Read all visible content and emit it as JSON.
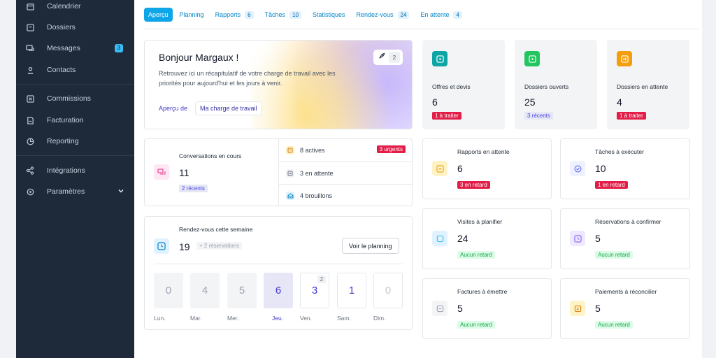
{
  "sidebar": {
    "items": [
      {
        "label": "Calendrier",
        "icon": "calendar-icon"
      },
      {
        "label": "Dossiers",
        "icon": "folder-icon"
      },
      {
        "label": "Messages",
        "icon": "messages-icon",
        "badge": "3"
      },
      {
        "label": "Contacts",
        "icon": "user-icon"
      },
      {
        "label": "Commissions",
        "icon": "commission-icon"
      },
      {
        "label": "Facturation",
        "icon": "invoice-icon"
      },
      {
        "label": "Reporting",
        "icon": "pie-chart-icon"
      },
      {
        "label": "Intégrations",
        "icon": "share-icon"
      },
      {
        "label": "Paramètres",
        "icon": "settings-icon"
      }
    ]
  },
  "tabs": [
    {
      "label": "Aperçu"
    },
    {
      "label": "Planning"
    },
    {
      "label": "Rapports",
      "count": "6"
    },
    {
      "label": "Tâches",
      "count": "10"
    },
    {
      "label": "Statistiques"
    },
    {
      "label": "Rendez-vous",
      "count": "24"
    },
    {
      "label": "En attente",
      "count": "4"
    }
  ],
  "welcome": {
    "title": "Bonjour Margaux !",
    "text": "Retrouvez ici un récapitulatif de votre charge de travail avec les priorités pour aujourd'hui et les jours à venir.",
    "apercu_label": "Aperçu de",
    "button": "Ma charge de travail",
    "rocket_count": "2"
  },
  "top_stats": [
    {
      "label": "Offres et devis",
      "value": "6",
      "badge": "1 à traiter",
      "badge_style": "red",
      "icon_color": "#0ea5a4"
    },
    {
      "label": "Dossiers ouverts",
      "value": "25",
      "badge": "3 récents",
      "badge_style": "lav",
      "icon_color": "#22c55e"
    },
    {
      "label": "Dossiers en attente",
      "value": "4",
      "badge": "1 à traiter",
      "badge_style": "red",
      "icon_color": "#f59e0b"
    }
  ],
  "conversations": {
    "label": "Conversations en cours",
    "value": "11",
    "badge": "2 récents",
    "rows": [
      {
        "text": "8 actives",
        "badge": "3 urgents"
      },
      {
        "text": "3 en attente"
      },
      {
        "text": "4 brouillons"
      }
    ]
  },
  "rdv": {
    "label": "Rendez-vous cette semaine",
    "value": "19",
    "extra": "+ 2 réservations",
    "button": "Voir le planning",
    "days": [
      {
        "label": "Lun.",
        "value": "0"
      },
      {
        "label": "Mar.",
        "value": "4"
      },
      {
        "label": "Mer.",
        "value": "5"
      },
      {
        "label": "Jeu.",
        "value": "6"
      },
      {
        "label": "Ven.",
        "value": "3",
        "sup": "2"
      },
      {
        "label": "Sam.",
        "value": "1"
      },
      {
        "label": "Dim.",
        "value": "0"
      }
    ]
  },
  "tasks": [
    {
      "label": "Rapports en attente",
      "value": "6",
      "badge": "3 en retard",
      "badge_style": "red",
      "icon": "report-icon",
      "icon_bg": "#fef3c7",
      "icon_fg": "#f59e0b"
    },
    {
      "label": "Tâches à exécuter",
      "value": "10",
      "badge": "1 en retard",
      "badge_style": "red",
      "icon": "check-icon",
      "icon_bg": "#eef2ff",
      "icon_fg": "#6366f1"
    },
    {
      "label": "Visites à planifier",
      "value": "24",
      "badge": "Aucun retard",
      "badge_style": "green",
      "icon": "visit-icon",
      "icon_bg": "#e0f2fe",
      "icon_fg": "#38bdf8"
    },
    {
      "label": "Réservations à confirmer",
      "value": "5",
      "badge": "Aucun retard",
      "badge_style": "green",
      "icon": "clock-icon",
      "icon_bg": "#ede9fe",
      "icon_fg": "#8b5cf6"
    },
    {
      "label": "Factures à émettre",
      "value": "5",
      "badge": "Aucun retard",
      "badge_style": "green",
      "icon": "invoice-icon",
      "icon_bg": "#f3f4f6",
      "icon_fg": "#9ca3af"
    },
    {
      "label": "Paiements à réconcilier",
      "value": "5",
      "badge": "Aucun retard",
      "badge_style": "green",
      "icon": "payment-icon",
      "icon_bg": "#fef3c7",
      "icon_fg": "#d97706"
    }
  ]
}
